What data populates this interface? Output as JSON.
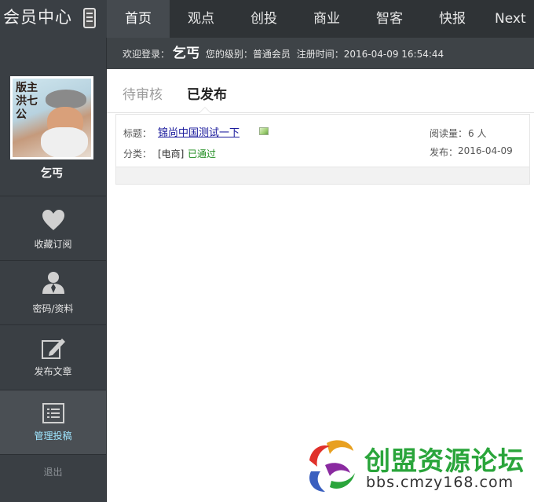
{
  "brand": {
    "title": "会员中心"
  },
  "nav": [
    {
      "label": "首页",
      "active": true
    },
    {
      "label": "观点"
    },
    {
      "label": "创投"
    },
    {
      "label": "商业"
    },
    {
      "label": "智客"
    },
    {
      "label": "快报"
    },
    {
      "label": "Next"
    }
  ],
  "subbar": {
    "welcome": "欢迎登录：",
    "username": "乞丐",
    "level_label": "您的级别：",
    "level": "普通会员",
    "reg_label": "注册时间：",
    "reg_time": "2016-04-09 16:54:44"
  },
  "profile": {
    "avatar_text": "版主洪七公",
    "name": "乞丐"
  },
  "sidebar": {
    "items": [
      {
        "label": "收藏订阅",
        "icon": "heart-icon"
      },
      {
        "label": "密码/资料",
        "icon": "user-icon"
      },
      {
        "label": "发布文章",
        "icon": "edit-icon"
      },
      {
        "label": "管理投稿",
        "icon": "list-icon",
        "active": true
      }
    ],
    "logout": "退出"
  },
  "tabs": [
    {
      "label": "待审核"
    },
    {
      "label": "已发布",
      "active": true
    }
  ],
  "article": {
    "title_label": "标题：",
    "title": "锦尚中国测试一下",
    "category_label": "分类：",
    "category": "[电商]",
    "status": "已通过",
    "views_label": "阅读量：",
    "views": "6 人",
    "publish_label": "发布：",
    "publish_date": "2016-04-09"
  },
  "watermark": {
    "title": "创盟资源论坛",
    "url": "bbs.cmzy168.com"
  },
  "colors": {
    "nav_bg": "#2f3336",
    "sidebar_bg": "#3a3f44",
    "active_label": "#9fe6ff",
    "status_green": "#1e8c1e",
    "link_blue": "#1a1a9c",
    "watermark_green": "#2aa53b"
  }
}
